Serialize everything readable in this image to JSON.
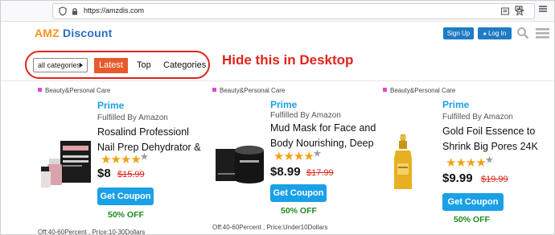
{
  "browser": {
    "url": "https://amzdis.com"
  },
  "header": {
    "logo_part1": "AMZ",
    "logo_part2": "Discount",
    "sign_up": "Sign Up",
    "log_in": "Log In"
  },
  "nav": {
    "select_value": "all categories",
    "latest": "Latest",
    "top": "Top",
    "categories": "Categories"
  },
  "annotation": "Hide this in Desktop",
  "colors": {
    "accent_blue": "#1aa0e6",
    "logo_orange": "#f7941d",
    "logo_blue": "#2a6ebf",
    "annotation_red": "#e0241b",
    "latest_orange": "#e75a2b",
    "star_gold": "#f0a21a",
    "off_green": "#1e8a1e"
  },
  "products": [
    {
      "category": "Beauty&Personal Care",
      "prime": "Prime",
      "fulfilled": "Fulfilled By Amazon",
      "title_line1": "Rosalind Professionl",
      "title_line2": "Nail Prep Dehydrator &",
      "rating": 4,
      "price": "$8",
      "old_price": "$15.99",
      "coupon": "Get Coupon",
      "off": "50% OFF",
      "meta": "Off:40-60Percent , Price:10-30Dollars",
      "image_icon": "nail-kit-icon"
    },
    {
      "category": "Beauty&Personal Care",
      "prime": "Prime",
      "fulfilled": "Fulfilled By Amazon",
      "title_line1": "Mud Mask for Face and",
      "title_line2": "Body Nourishing, Deep",
      "rating": 4,
      "price": "$8.99",
      "old_price": "$17.99",
      "coupon": "Get Coupon",
      "off": "50% OFF",
      "meta": "Off:40-60Percent , Price:Under10Dollars",
      "image_icon": "mud-mask-jar-icon"
    },
    {
      "category": "Beauty&Personal Care",
      "prime": "Prime",
      "fulfilled": "Fulfilled By Amazon",
      "title_line1": "Gold Foil Essence to",
      "title_line2": "Shrink Big Pores 24K",
      "rating": 4,
      "price": "$9.99",
      "old_price": "$19.99",
      "coupon": "Get Coupon",
      "off": "50% OFF",
      "meta": "",
      "image_icon": "gold-serum-bottle-icon"
    }
  ]
}
